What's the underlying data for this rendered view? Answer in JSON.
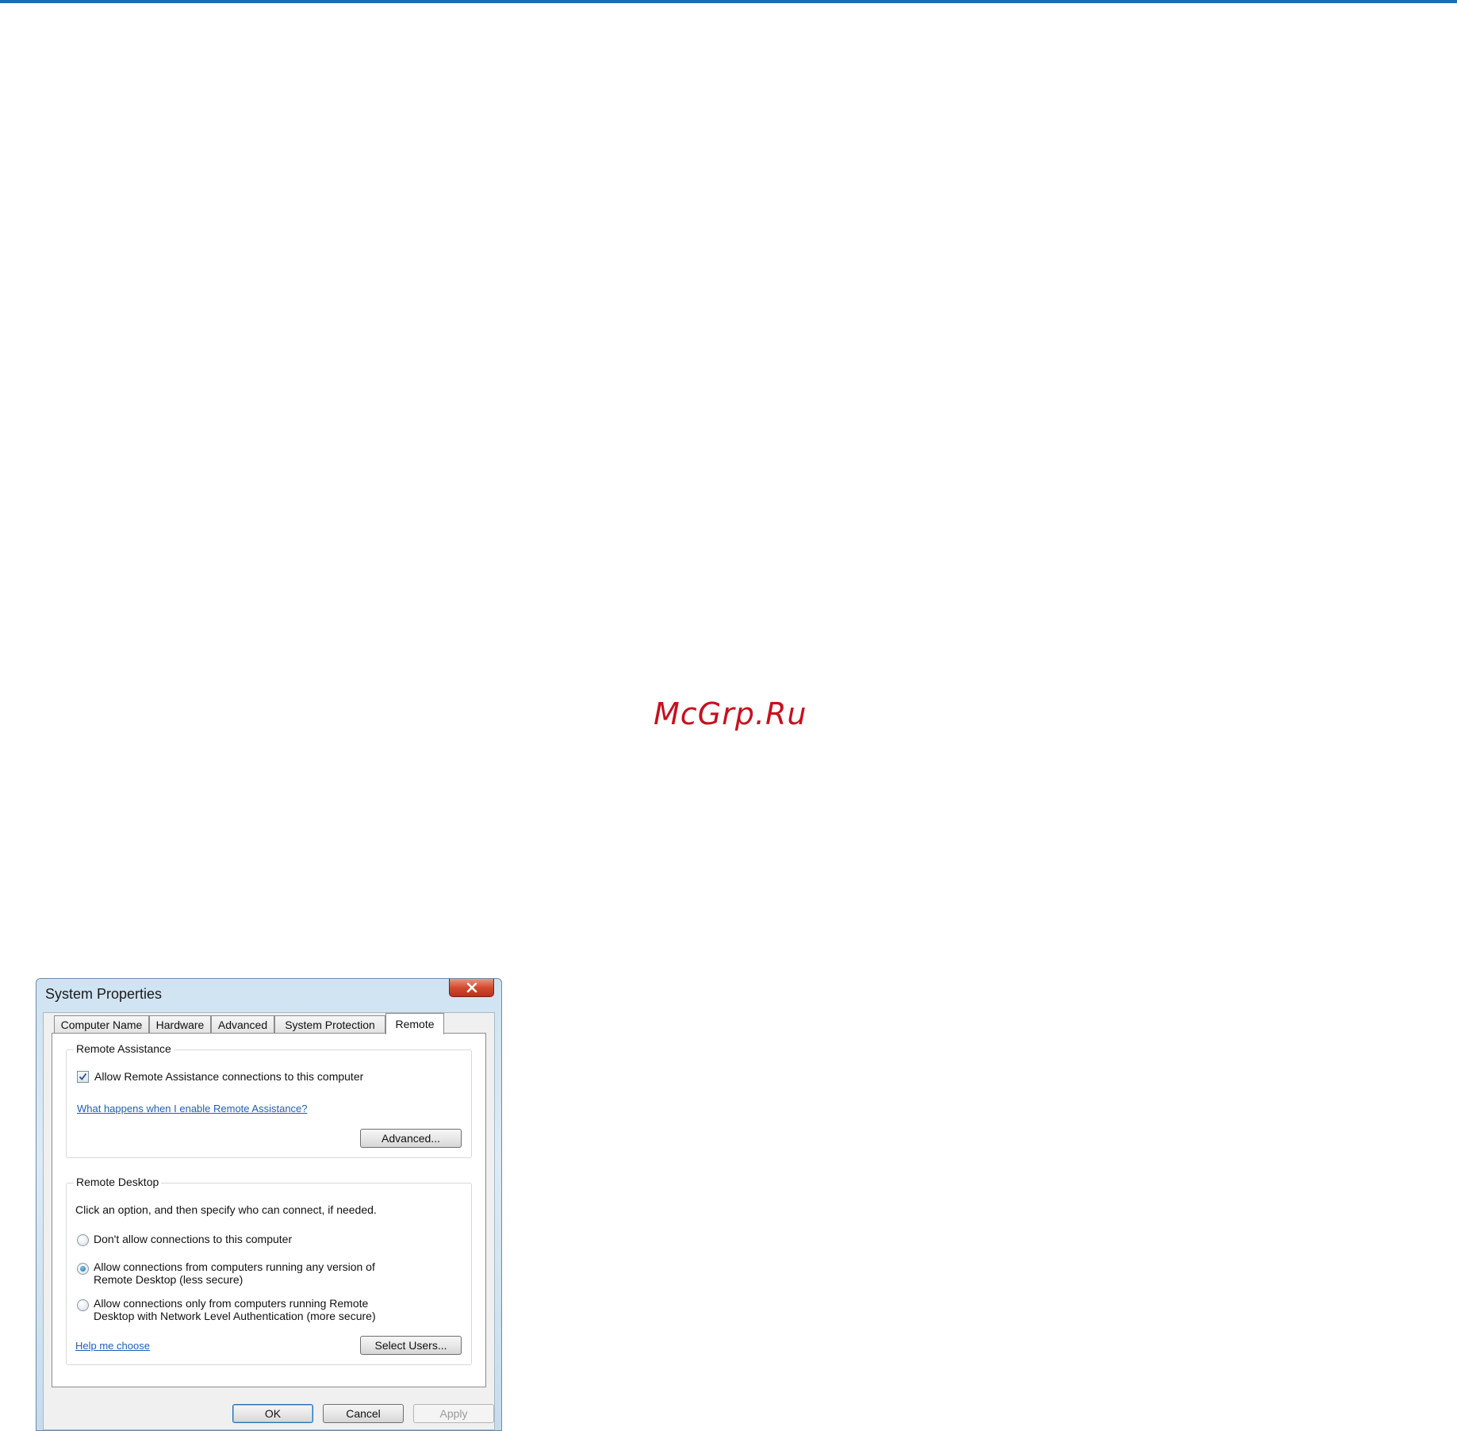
{
  "watermark": "McGrp.Ru",
  "dialog": {
    "title": "System Properties",
    "tabs": [
      {
        "label": "Computer Name",
        "active": false
      },
      {
        "label": "Hardware",
        "active": false
      },
      {
        "label": "Advanced",
        "active": false
      },
      {
        "label": "System Protection",
        "active": false
      },
      {
        "label": "Remote",
        "active": true
      }
    ],
    "remote_assistance": {
      "title": "Remote Assistance",
      "checkbox_label": "Allow Remote Assistance connections to this computer",
      "checkbox_checked": true,
      "help_link": "What happens when I enable Remote Assistance?",
      "advanced_button": "Advanced..."
    },
    "remote_desktop": {
      "title": "Remote Desktop",
      "instruction": "Click an option, and then specify who can connect, if needed.",
      "options": [
        {
          "line1": "Don't allow connections to this computer",
          "line2": "",
          "checked": false
        },
        {
          "line1": "Allow connections from computers running any version of",
          "line2": "Remote Desktop (less secure)",
          "checked": true
        },
        {
          "line1": "Allow connections only from computers running Remote",
          "line2": "Desktop with Network Level Authentication (more secure)",
          "checked": false
        }
      ],
      "help_link": "Help me choose",
      "select_users_button": "Select Users..."
    },
    "buttons": {
      "ok": "OK",
      "cancel": "Cancel",
      "apply": "Apply"
    }
  }
}
